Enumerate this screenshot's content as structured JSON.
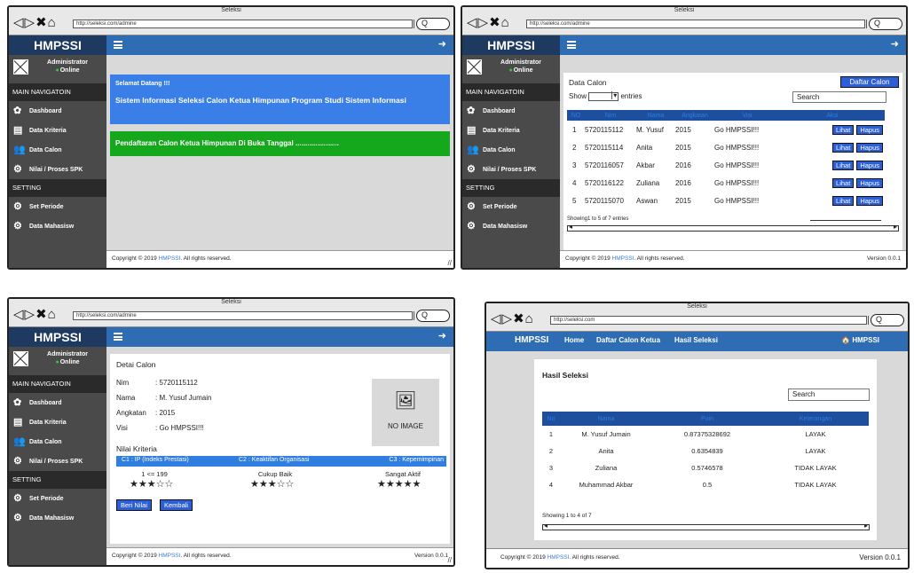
{
  "browser": {
    "title": "Seleksi",
    "url_admin": "http://seleksi.com/admine",
    "url_public": "http://seleksi.com",
    "search_button": "Q"
  },
  "icons": {
    "back": "◁",
    "forward": "▷",
    "stop": "✖",
    "home": "⌂",
    "menu": "hamburger-icon",
    "logout": "➜",
    "dashboard": "✿",
    "criteria": "▤",
    "candidates": "👥",
    "gears": "⚙",
    "image": "🖼",
    "house": "🏠"
  },
  "admin": {
    "brand": "HMPSSI",
    "user_name": "Administrator",
    "user_status": "Online",
    "nav_header": "MAIN NAVIGATOIN",
    "menu": [
      "Dashboard",
      "Data Kriteria",
      "Data Calon",
      "Nilai / Proses SPK"
    ],
    "setting_header": "SETTING",
    "setting_menu": [
      "Set Periode",
      "Data Mahasisw"
    ],
    "footer_prefix": "Copyright © 2019",
    "footer_link": "HMPSSI",
    "footer_suffix": ". All rights reserved.",
    "version": "Version 0.0.1"
  },
  "dashboard": {
    "welcome": "Selamat Datang !!!",
    "system_title": "Sistem Informasi Seleksi Calon Ketua Himpunan Program Studi Sistem Informasi",
    "announcement": "Pendaftaran Calon Ketua Himpunan Di Buka Tanggal ......................"
  },
  "data_calon": {
    "title": "Data Calon",
    "button": "Daftar Calon",
    "show": "Show",
    "entries": "entries",
    "search_label": "Search",
    "columns": [
      "NO",
      "Nim",
      "Nama",
      "Angkatan",
      "Visi",
      "Aksi"
    ],
    "rows": [
      [
        "1",
        "5720115112",
        "M. Yusuf",
        "2015",
        "Go HMPSSI!!!"
      ],
      [
        "2",
        "5720115114",
        "Anita",
        "2015",
        "Go HMPSSI!!!"
      ],
      [
        "3",
        "5720116057",
        "Akbar",
        "2016",
        "Go HMPSSI!!!"
      ],
      [
        "4",
        "5720116122",
        "Zuliana",
        "2016",
        "Go HMPSSI!!!"
      ],
      [
        "5",
        "5720115070",
        "Aswan",
        "2015",
        "Go HMPSSI!!!"
      ]
    ],
    "view_label": "Lihat",
    "delete_label": "Hapus",
    "info": "Showing1 to 5 of 7 entries"
  },
  "detail": {
    "title": "Detai Calon",
    "fields": [
      {
        "key": "Nim",
        "value": ": 5720115112"
      },
      {
        "key": "Nama",
        "value": ": M. Yusuf Jumain"
      },
      {
        "key": "Angkatan",
        "value": ": 2015"
      },
      {
        "key": "Visi",
        "value": ": Go HMPSSI!!!"
      }
    ],
    "no_image": "NO IMAGE",
    "criteria_title": "Nilai Kriteria",
    "criteria": [
      {
        "name": "C1 : IP (Indeks Prestasi)",
        "value": "1 <= 199",
        "stars": 2.5
      },
      {
        "name": "C2 : Keaktifan Organisasi",
        "value": "Cukup Baik",
        "stars": 3
      },
      {
        "name": "C3 : Kepemimpinan",
        "value": "Sangat Aktif",
        "stars": 5
      }
    ],
    "btn_rate": "Beri Nilai",
    "btn_back": "Kembali"
  },
  "public": {
    "brand": "HMPSSI",
    "nav": [
      "Home",
      "Daftar Calon Ketua",
      "Hasil Seleksi"
    ],
    "right_link": "HMPSSI",
    "card_title": "Hasil Seleksi",
    "search": "Search",
    "columns": [
      "No",
      "Nama",
      "Poin",
      "Keterangan"
    ],
    "rows": [
      [
        "1",
        "M. Yusuf Jumain",
        "0.87375328692",
        "LAYAK"
      ],
      [
        "2",
        "Anita",
        "0.6354839",
        "LAYAK"
      ],
      [
        "3",
        "Zuliana",
        "0.5746578",
        "TIDAK LAYAK"
      ],
      [
        "4",
        "Muhammad Akbar",
        "0.5",
        "TIDAK LAYAK"
      ]
    ],
    "info": "Showing 1 to 4 of 7",
    "footer_prefix": "Copyright © 2019",
    "footer_link": "HMPSSI",
    "footer_suffix": ". All rights reserved.",
    "version": "Version  0.0.1"
  }
}
